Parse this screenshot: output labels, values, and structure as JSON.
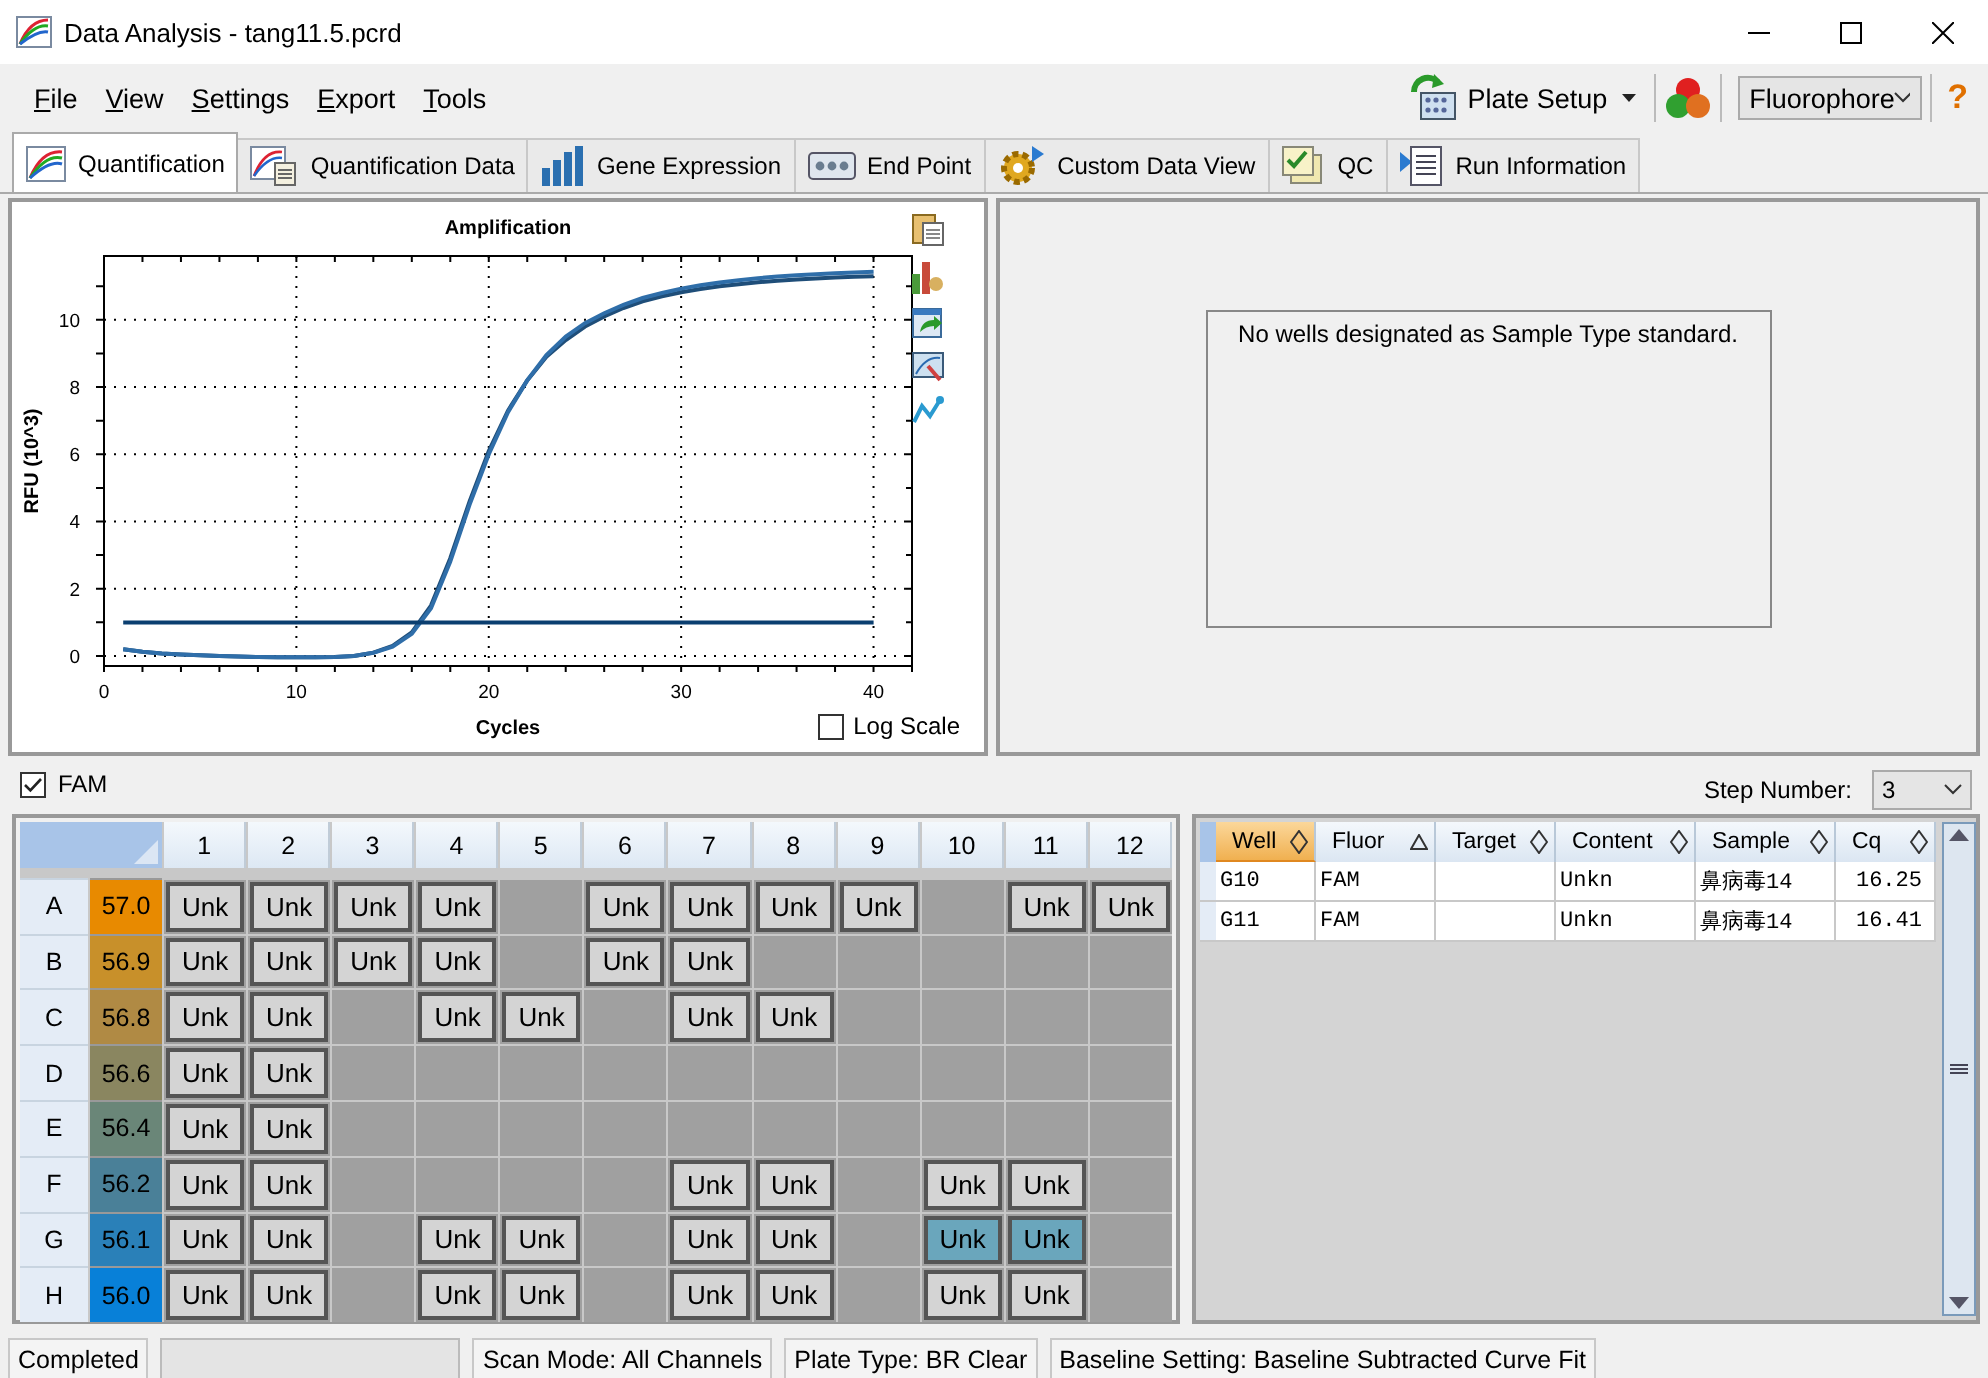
{
  "window": {
    "title": "Data Analysis - tang11.5.pcrd"
  },
  "menu": [
    "File",
    "View",
    "Settings",
    "Export",
    "Tools"
  ],
  "toolbar": {
    "plate_setup": "Plate Setup",
    "fluorophore": "Fluorophore",
    "help": "?"
  },
  "tabs": [
    {
      "label": "Quantification",
      "selected": true
    },
    {
      "label": "Quantification Data",
      "selected": false
    },
    {
      "label": "Gene Expression",
      "selected": false
    },
    {
      "label": "End Point",
      "selected": false
    },
    {
      "label": "Custom Data View",
      "selected": false
    },
    {
      "label": "QC",
      "selected": false
    },
    {
      "label": "Run Information",
      "selected": false
    }
  ],
  "chart": {
    "chart_data": {
      "type": "line",
      "title": "Amplification",
      "xlabel": "Cycles",
      "ylabel": "RFU (10^3)",
      "xlim": [
        0,
        42
      ],
      "ylim": [
        -0.3,
        11.9
      ],
      "xticks": [
        0,
        10,
        20,
        30,
        40
      ],
      "yticks": [
        0,
        2,
        4,
        6,
        8,
        10
      ],
      "grid": true,
      "x": [
        1,
        2,
        3,
        4,
        5,
        6,
        7,
        8,
        9,
        10,
        11,
        12,
        13,
        14,
        15,
        16,
        17,
        18,
        19,
        20,
        21,
        22,
        23,
        24,
        25,
        26,
        27,
        28,
        29,
        30,
        31,
        32,
        33,
        34,
        35,
        36,
        37,
        38,
        39,
        40
      ],
      "series": [
        {
          "color": "#1f4e79",
          "values": [
            0.2,
            0.12,
            0.07,
            0.04,
            0.02,
            0.0,
            -0.02,
            -0.03,
            -0.04,
            -0.04,
            -0.04,
            -0.03,
            0.0,
            0.1,
            0.3,
            0.7,
            1.5,
            2.9,
            4.6,
            6.1,
            7.3,
            8.2,
            8.9,
            9.4,
            9.8,
            10.1,
            10.35,
            10.55,
            10.7,
            10.82,
            10.92,
            11.0,
            11.06,
            11.12,
            11.16,
            11.2,
            11.23,
            11.26,
            11.28,
            11.3
          ]
        },
        {
          "color": "#2f6ea9",
          "values": [
            0.2,
            0.12,
            0.07,
            0.04,
            0.02,
            0.0,
            -0.02,
            -0.03,
            -0.04,
            -0.04,
            -0.04,
            -0.03,
            0.0,
            0.09,
            0.28,
            0.66,
            1.42,
            2.8,
            4.5,
            6.0,
            7.25,
            8.2,
            8.95,
            9.5,
            9.9,
            10.2,
            10.45,
            10.65,
            10.8,
            10.93,
            11.03,
            11.11,
            11.18,
            11.24,
            11.29,
            11.33,
            11.36,
            11.39,
            11.41,
            11.43
          ]
        },
        {
          "color": "#0b3f70",
          "values": [
            1,
            1,
            1,
            1,
            1,
            1,
            1,
            1,
            1,
            1,
            1,
            1,
            1,
            1,
            1,
            1,
            1,
            1,
            1,
            1,
            1,
            1,
            1,
            1,
            1,
            1,
            1,
            1,
            1,
            1,
            1,
            1,
            1,
            1,
            1,
            1,
            1,
            1,
            1,
            1
          ]
        }
      ]
    },
    "log_scale": {
      "label": "Log Scale",
      "checked": false
    }
  },
  "standard_curve": {
    "message": "No wells designated as Sample Type standard."
  },
  "fluor_filter": {
    "label": "FAM",
    "checked": true
  },
  "step_number": {
    "label": "Step Number:",
    "value": "3"
  },
  "plate": {
    "columns": [
      "1",
      "2",
      "3",
      "4",
      "5",
      "6",
      "7",
      "8",
      "9",
      "10",
      "11",
      "12"
    ],
    "rows": [
      {
        "label": "A",
        "temp": "57.0",
        "color": "#e88a00",
        "wells": [
          {
            "kind": "sample",
            "label": "Unk",
            "selected": false
          },
          {
            "kind": "sample",
            "label": "Unk",
            "selected": false
          },
          {
            "kind": "sample",
            "label": "Unk",
            "selected": false
          },
          {
            "kind": "sample",
            "label": "Unk",
            "selected": false
          },
          {
            "kind": "empty"
          },
          {
            "kind": "sample",
            "label": "Unk",
            "selected": false
          },
          {
            "kind": "sample",
            "label": "Unk",
            "selected": false
          },
          {
            "kind": "sample",
            "label": "Unk",
            "selected": false
          },
          {
            "kind": "sample",
            "label": "Unk",
            "selected": false
          },
          {
            "kind": "empty"
          },
          {
            "kind": "sample",
            "label": "Unk",
            "selected": false
          },
          {
            "kind": "sample",
            "label": "Unk",
            "selected": false
          }
        ]
      },
      {
        "label": "B",
        "temp": "56.9",
        "color": "#c8902a",
        "wells": [
          {
            "kind": "sample",
            "label": "Unk",
            "selected": false
          },
          {
            "kind": "sample",
            "label": "Unk",
            "selected": false
          },
          {
            "kind": "sample",
            "label": "Unk",
            "selected": false
          },
          {
            "kind": "sample",
            "label": "Unk",
            "selected": false
          },
          {
            "kind": "empty"
          },
          {
            "kind": "sample",
            "label": "Unk",
            "selected": false
          },
          {
            "kind": "sample",
            "label": "Unk",
            "selected": false
          },
          {
            "kind": "empty"
          },
          {
            "kind": "empty"
          },
          {
            "kind": "empty"
          },
          {
            "kind": "empty"
          },
          {
            "kind": "empty"
          }
        ]
      },
      {
        "label": "C",
        "temp": "56.8",
        "color": "#b08a44",
        "wells": [
          {
            "kind": "sample",
            "label": "Unk",
            "selected": false
          },
          {
            "kind": "sample",
            "label": "Unk",
            "selected": false
          },
          {
            "kind": "empty"
          },
          {
            "kind": "sample",
            "label": "Unk",
            "selected": false
          },
          {
            "kind": "sample",
            "label": "Unk",
            "selected": false
          },
          {
            "kind": "empty"
          },
          {
            "kind": "sample",
            "label": "Unk",
            "selected": false
          },
          {
            "kind": "sample",
            "label": "Unk",
            "selected": false
          },
          {
            "kind": "empty"
          },
          {
            "kind": "empty"
          },
          {
            "kind": "empty"
          },
          {
            "kind": "empty"
          }
        ]
      },
      {
        "label": "D",
        "temp": "56.6",
        "color": "#8a8660",
        "wells": [
          {
            "kind": "sample",
            "label": "Unk",
            "selected": false
          },
          {
            "kind": "sample",
            "label": "Unk",
            "selected": false
          },
          {
            "kind": "empty"
          },
          {
            "kind": "empty"
          },
          {
            "kind": "empty"
          },
          {
            "kind": "empty"
          },
          {
            "kind": "empty"
          },
          {
            "kind": "empty"
          },
          {
            "kind": "empty"
          },
          {
            "kind": "empty"
          },
          {
            "kind": "empty"
          },
          {
            "kind": "empty"
          }
        ]
      },
      {
        "label": "E",
        "temp": "56.4",
        "color": "#6a8678",
        "wells": [
          {
            "kind": "sample",
            "label": "Unk",
            "selected": false
          },
          {
            "kind": "sample",
            "label": "Unk",
            "selected": false
          },
          {
            "kind": "empty"
          },
          {
            "kind": "empty"
          },
          {
            "kind": "empty"
          },
          {
            "kind": "empty"
          },
          {
            "kind": "empty"
          },
          {
            "kind": "empty"
          },
          {
            "kind": "empty"
          },
          {
            "kind": "empty"
          },
          {
            "kind": "empty"
          },
          {
            "kind": "empty"
          }
        ]
      },
      {
        "label": "F",
        "temp": "56.2",
        "color": "#4a8098",
        "wells": [
          {
            "kind": "sample",
            "label": "Unk",
            "selected": false
          },
          {
            "kind": "sample",
            "label": "Unk",
            "selected": false
          },
          {
            "kind": "empty"
          },
          {
            "kind": "empty"
          },
          {
            "kind": "empty"
          },
          {
            "kind": "empty"
          },
          {
            "kind": "sample",
            "label": "Unk",
            "selected": false
          },
          {
            "kind": "sample",
            "label": "Unk",
            "selected": false
          },
          {
            "kind": "empty"
          },
          {
            "kind": "sample",
            "label": "Unk",
            "selected": false
          },
          {
            "kind": "sample",
            "label": "Unk",
            "selected": false
          },
          {
            "kind": "empty"
          }
        ]
      },
      {
        "label": "G",
        "temp": "56.1",
        "color": "#2a80b8",
        "wells": [
          {
            "kind": "sample",
            "label": "Unk",
            "selected": false
          },
          {
            "kind": "sample",
            "label": "Unk",
            "selected": false
          },
          {
            "kind": "empty"
          },
          {
            "kind": "sample",
            "label": "Unk",
            "selected": false
          },
          {
            "kind": "sample",
            "label": "Unk",
            "selected": false
          },
          {
            "kind": "empty"
          },
          {
            "kind": "sample",
            "label": "Unk",
            "selected": false
          },
          {
            "kind": "sample",
            "label": "Unk",
            "selected": false
          },
          {
            "kind": "empty"
          },
          {
            "kind": "sample",
            "label": "Unk",
            "selected": true
          },
          {
            "kind": "sample",
            "label": "Unk",
            "selected": true
          },
          {
            "kind": "empty"
          }
        ]
      },
      {
        "label": "H",
        "temp": "56.0",
        "color": "#0880d8",
        "wells": [
          {
            "kind": "sample",
            "label": "Unk",
            "selected": false
          },
          {
            "kind": "sample",
            "label": "Unk",
            "selected": false
          },
          {
            "kind": "empty"
          },
          {
            "kind": "sample",
            "label": "Unk",
            "selected": false
          },
          {
            "kind": "sample",
            "label": "Unk",
            "selected": false
          },
          {
            "kind": "empty"
          },
          {
            "kind": "sample",
            "label": "Unk",
            "selected": false
          },
          {
            "kind": "sample",
            "label": "Unk",
            "selected": false
          },
          {
            "kind": "empty"
          },
          {
            "kind": "sample",
            "label": "Unk",
            "selected": false
          },
          {
            "kind": "sample",
            "label": "Unk",
            "selected": false
          },
          {
            "kind": "empty"
          }
        ]
      }
    ]
  },
  "results_table": {
    "columns": [
      {
        "label": "Well",
        "sort_ascending": false,
        "selected": true
      },
      {
        "label": "Fluor",
        "sort_ascending": true,
        "selected": false
      },
      {
        "label": "Target",
        "sort_ascending": false,
        "selected": false
      },
      {
        "label": "Content",
        "sort_ascending": false,
        "selected": false
      },
      {
        "label": "Sample",
        "sort_ascending": false,
        "selected": false
      },
      {
        "label": "Cq",
        "sort_ascending": false,
        "selected": false
      }
    ],
    "rows": [
      {
        "well": "G10",
        "fluor": "FAM",
        "content": "Unkn",
        "sample": "鼻病毒14",
        "cq": "16.25"
      },
      {
        "well": "G11",
        "fluor": "FAM",
        "content": "Unkn",
        "sample": "鼻病毒14",
        "cq": "16.41"
      }
    ]
  },
  "status_bar": {
    "state": "Completed",
    "scan_mode": "Scan Mode: All Channels",
    "plate_type": "Plate Type: BR Clear",
    "baseline": "Baseline Setting: Baseline Subtracted Curve Fit"
  }
}
